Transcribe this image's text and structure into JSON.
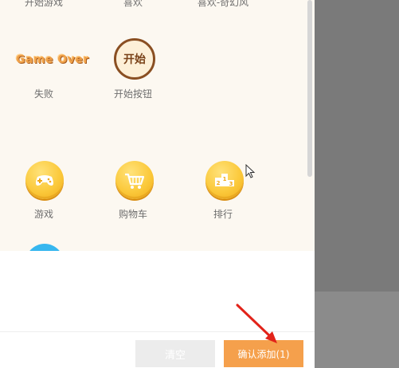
{
  "grid": {
    "top_labels": [
      "开始游戏",
      "喜欢",
      "喜欢-奇幻风"
    ],
    "row2": [
      {
        "label": "失败",
        "logo_text": "Game Over"
      },
      {
        "label": "开始按钮",
        "icon_text": "开始"
      }
    ],
    "row3": [
      {
        "label": "游戏",
        "icon": "gamepad-icon"
      },
      {
        "label": "购物车",
        "icon": "cart-icon"
      },
      {
        "label": "排行",
        "icon": "podium-icon",
        "rank_numbers": [
          "2",
          "1",
          "3"
        ]
      }
    ]
  },
  "footer": {
    "clear_label": "清空",
    "confirm_label": "确认添加(1)"
  },
  "colors": {
    "accent": "#f5a04c",
    "coin": "#fbc93b",
    "arrow": "#e2231a"
  }
}
